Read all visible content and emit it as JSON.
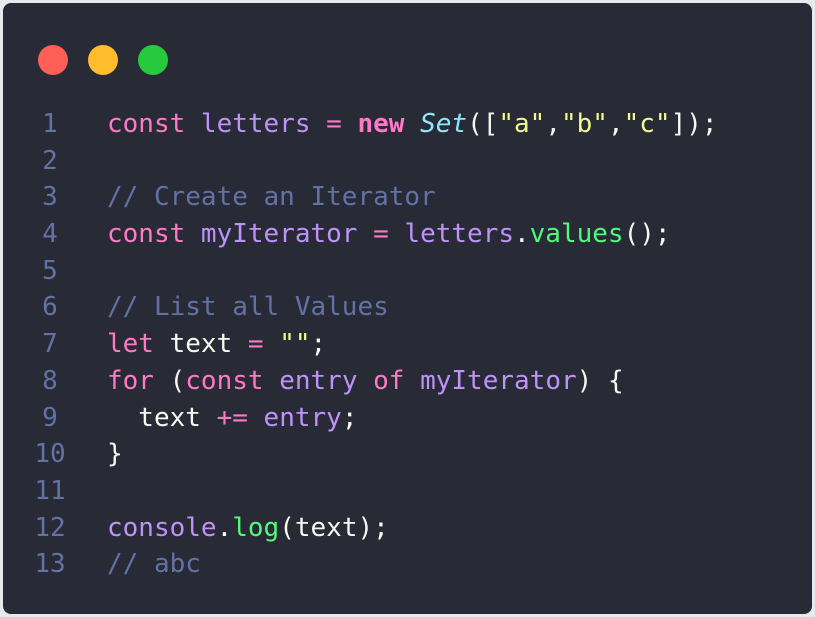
{
  "window": {
    "controls": [
      {
        "name": "close",
        "color": "#ff5f56"
      },
      {
        "name": "minimize",
        "color": "#ffbd2e"
      },
      {
        "name": "maximize",
        "color": "#27c93f"
      }
    ]
  },
  "code": {
    "lines": [
      {
        "n": "1",
        "tokens": [
          {
            "t": "const ",
            "c": "kw"
          },
          {
            "t": "letters ",
            "c": "var"
          },
          {
            "t": "= ",
            "c": "kw"
          },
          {
            "t": "new ",
            "c": "kwb"
          },
          {
            "t": "Set",
            "c": "cls"
          },
          {
            "t": "([",
            "c": "pl"
          },
          {
            "t": "\"a\"",
            "c": "str"
          },
          {
            "t": ",",
            "c": "pl"
          },
          {
            "t": "\"b\"",
            "c": "str"
          },
          {
            "t": ",",
            "c": "pl"
          },
          {
            "t": "\"c\"",
            "c": "str"
          },
          {
            "t": "]);",
            "c": "pl"
          }
        ]
      },
      {
        "n": "2",
        "tokens": []
      },
      {
        "n": "3",
        "tokens": [
          {
            "t": "// Create an Iterator",
            "c": "cm"
          }
        ]
      },
      {
        "n": "4",
        "tokens": [
          {
            "t": "const ",
            "c": "kw"
          },
          {
            "t": "myIterator ",
            "c": "var"
          },
          {
            "t": "= ",
            "c": "kw"
          },
          {
            "t": "letters",
            "c": "var"
          },
          {
            "t": ".",
            "c": "pl"
          },
          {
            "t": "values",
            "c": "fn"
          },
          {
            "t": "();",
            "c": "pl"
          }
        ]
      },
      {
        "n": "5",
        "tokens": []
      },
      {
        "n": "6",
        "tokens": [
          {
            "t": "// List all Values",
            "c": "cm"
          }
        ]
      },
      {
        "n": "7",
        "tokens": [
          {
            "t": "let ",
            "c": "kw"
          },
          {
            "t": "text ",
            "c": "pl"
          },
          {
            "t": "= ",
            "c": "kw"
          },
          {
            "t": "\"\"",
            "c": "str"
          },
          {
            "t": ";",
            "c": "pl"
          }
        ]
      },
      {
        "n": "8",
        "tokens": [
          {
            "t": "for ",
            "c": "kw"
          },
          {
            "t": "(",
            "c": "pl"
          },
          {
            "t": "const ",
            "c": "kw"
          },
          {
            "t": "entry ",
            "c": "var"
          },
          {
            "t": "of ",
            "c": "kw"
          },
          {
            "t": "myIterator",
            "c": "var"
          },
          {
            "t": ") {",
            "c": "pl"
          }
        ]
      },
      {
        "n": "9",
        "tokens": [
          {
            "t": "  text ",
            "c": "pl"
          },
          {
            "t": "+= ",
            "c": "kw"
          },
          {
            "t": "entry",
            "c": "var"
          },
          {
            "t": ";",
            "c": "pl"
          }
        ]
      },
      {
        "n": "10",
        "tokens": [
          {
            "t": "}",
            "c": "pl"
          }
        ]
      },
      {
        "n": "11",
        "tokens": []
      },
      {
        "n": "12",
        "tokens": [
          {
            "t": "console",
            "c": "var"
          },
          {
            "t": ".",
            "c": "pl"
          },
          {
            "t": "log",
            "c": "fn"
          },
          {
            "t": "(text);",
            "c": "pl"
          }
        ]
      },
      {
        "n": "13",
        "tokens": [
          {
            "t": "// abc",
            "c": "cm"
          }
        ]
      }
    ]
  }
}
